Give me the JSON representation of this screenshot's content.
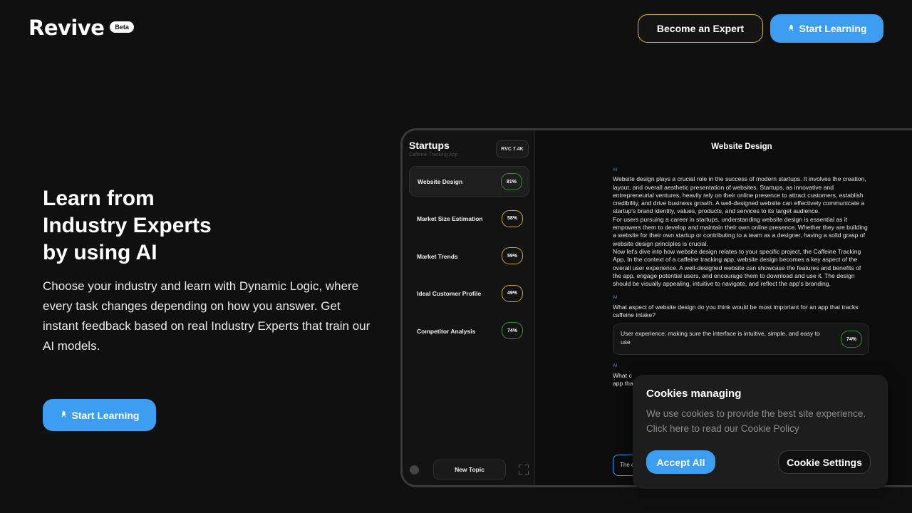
{
  "header": {
    "logo": "Revive",
    "badge": "Beta",
    "expert_btn": "Become an Expert",
    "learn_btn": "Start Learning",
    "learn_icon": "rocket-icon"
  },
  "hero": {
    "title_lines": [
      "Learn from",
      "Industry Experts",
      "by using AI"
    ],
    "description": "Choose your industry and learn with Dynamic Logic, where every task changes depending on how you answer. Get instant feedback based on real Industry Experts that train our AI models.",
    "cta": "Start Learning"
  },
  "app": {
    "sidebar": {
      "title": "Startups",
      "subtitle": "Caffeine Tracking App",
      "rvc": "RVC 7.4K",
      "topics": [
        {
          "label": "Website Design",
          "pct": "81%",
          "color": "green",
          "active": true
        },
        {
          "label": "Market Size Estimation",
          "pct": "58%",
          "color": "yellow",
          "active": false
        },
        {
          "label": "Market Trends",
          "pct": "59%",
          "color": "yellow",
          "active": false
        },
        {
          "label": "Ideal Customer Profile",
          "pct": "49%",
          "color": "yellow",
          "active": false
        },
        {
          "label": "Competitor Analysis",
          "pct": "74%",
          "color": "green",
          "active": false
        }
      ],
      "new_topic": "New Topic"
    },
    "main": {
      "title": "Website Design",
      "ai_label": "AI",
      "msg1_p1": "Website design plays a crucial role in the success of modern startups. It involves the creation, layout, and overall aesthetic presentation of websites. Startups, as innovative and entrepreneurial ventures, heavily rely on their online presence to attract customers, establish credibility, and drive business growth. A well-designed website can effectively communicate a startup's brand identity, values, products, and services to its target audience.",
      "msg1_p2": "For users pursuing a career in startups, understanding website design is essential as it empowers them to develop and maintain their own online presence. Whether they are building a website for their own startup or contributing to a team as a designer, having a solid grasp of website design principles is crucial.",
      "msg1_p3": "Now let's dive into how website design relates to your specific project, the Caffeine Tracking App. In the context of a caffeine tracking app, website design becomes a key aspect of the overall user experience. A well-designed website can showcase the features and benefits of the app, engage potential users, and encourage them to download and use it. The design should be visually appealing, intuitive to navigate, and reflect the app's branding.",
      "msg2": "What aspect of website design do you think would be most important for an app that tracks caffeine intake?",
      "answer": "User experience; making sure the interface is intuitive, simple, and easy to use",
      "answer_pct": "74%",
      "msg3_visible": "What c",
      "msg3_visible2": "app tha",
      "input_visible": "The c"
    }
  },
  "cookie": {
    "title": "Cookies managing",
    "text": "We use cookies to provide the best site experience. Click here to read our Cookie Policy",
    "accept": "Accept All",
    "settings": "Cookie Settings"
  },
  "colors": {
    "accent": "#3d9df0",
    "expert_border": "#d8b44a",
    "pct_green": "#3c8c33",
    "pct_yellow": "#c4a444",
    "background": "#101011"
  }
}
